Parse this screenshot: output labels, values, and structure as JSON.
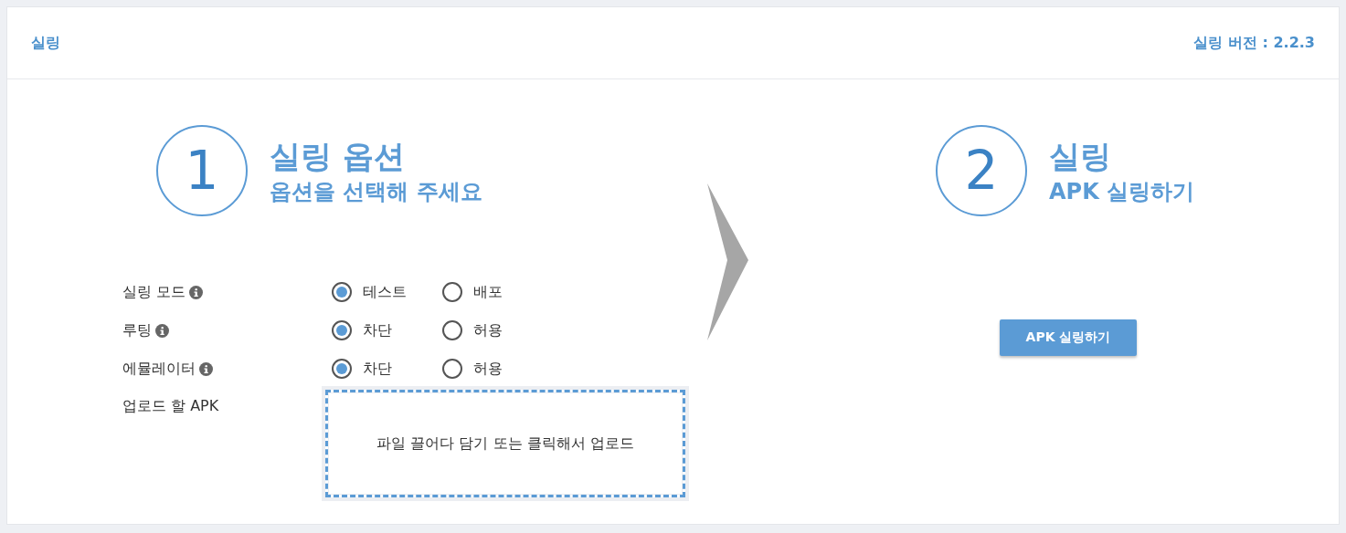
{
  "header": {
    "title": "실링",
    "version": "실링 버전 : 2.2.3"
  },
  "steps": [
    {
      "number": "1",
      "title": "실링 옵션",
      "subtitle": "옵션을 선택해 주세요"
    },
    {
      "number": "2",
      "title": "실링",
      "subtitle": "APK 실링하기"
    }
  ],
  "options": [
    {
      "label": "실링 모드",
      "info": true,
      "choices": [
        {
          "label": "테스트",
          "selected": true
        },
        {
          "label": "배포",
          "selected": false
        }
      ]
    },
    {
      "label": "루팅",
      "info": true,
      "choices": [
        {
          "label": "차단",
          "selected": true
        },
        {
          "label": "허용",
          "selected": false
        }
      ]
    },
    {
      "label": "에뮬레이터",
      "info": true,
      "choices": [
        {
          "label": "차단",
          "selected": true
        },
        {
          "label": "허용",
          "selected": false
        }
      ]
    }
  ],
  "upload": {
    "label": "업로드 할 APK",
    "dropzone": "파일 끌어다 담기 또는 클릭해서 업로드"
  },
  "action_button": "APK 실링하기"
}
